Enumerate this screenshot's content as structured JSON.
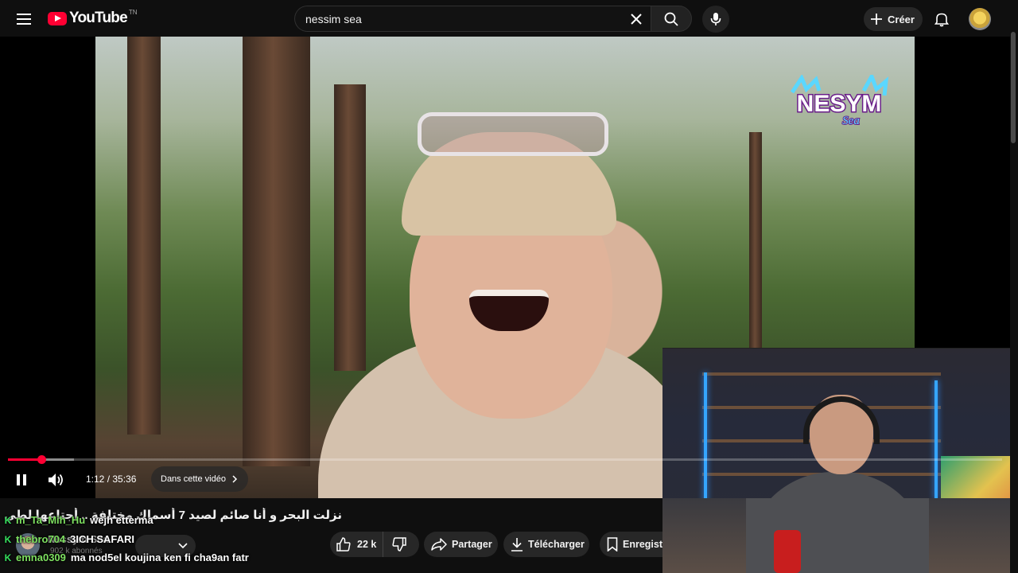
{
  "header": {
    "logo_text": "YouTube",
    "region_code": "TN",
    "search_value": "nessim sea",
    "create_label": "Créer"
  },
  "player": {
    "brand_logo_text": "NESYM",
    "brand_logo_sub": "Sea",
    "time_display": "1:12 / 35:36",
    "chapter_label": "Dans cette vidéo",
    "progress_played_fraction": 0.034,
    "progress_loaded_fraction": 0.066
  },
  "chat": [
    {
      "user": "m_Ta_Mih_Hu",
      "message": "wejh etterma"
    },
    {
      "user": "thebro704",
      "message": "3ICH SAFARI"
    },
    {
      "user": "emna0309",
      "message": "ma nod5el koujina ken fi cha9an fatr"
    }
  ],
  "video": {
    "title": "نزلت البحر و أنا صائم لصيد 7 أسماك مختلفة .. أجتاعها لطي  فطور رمضان!",
    "channel_name": "Nessym Sea",
    "subscribers": "902 k abonnés",
    "likes": "22 k",
    "share_label": "Partager",
    "download_label": "Télécharger",
    "save_label": "Enregistrer"
  },
  "colors": {
    "accent_red": "#ff0033",
    "background": "#0f0f0f",
    "chat_username": "#7ee060"
  }
}
